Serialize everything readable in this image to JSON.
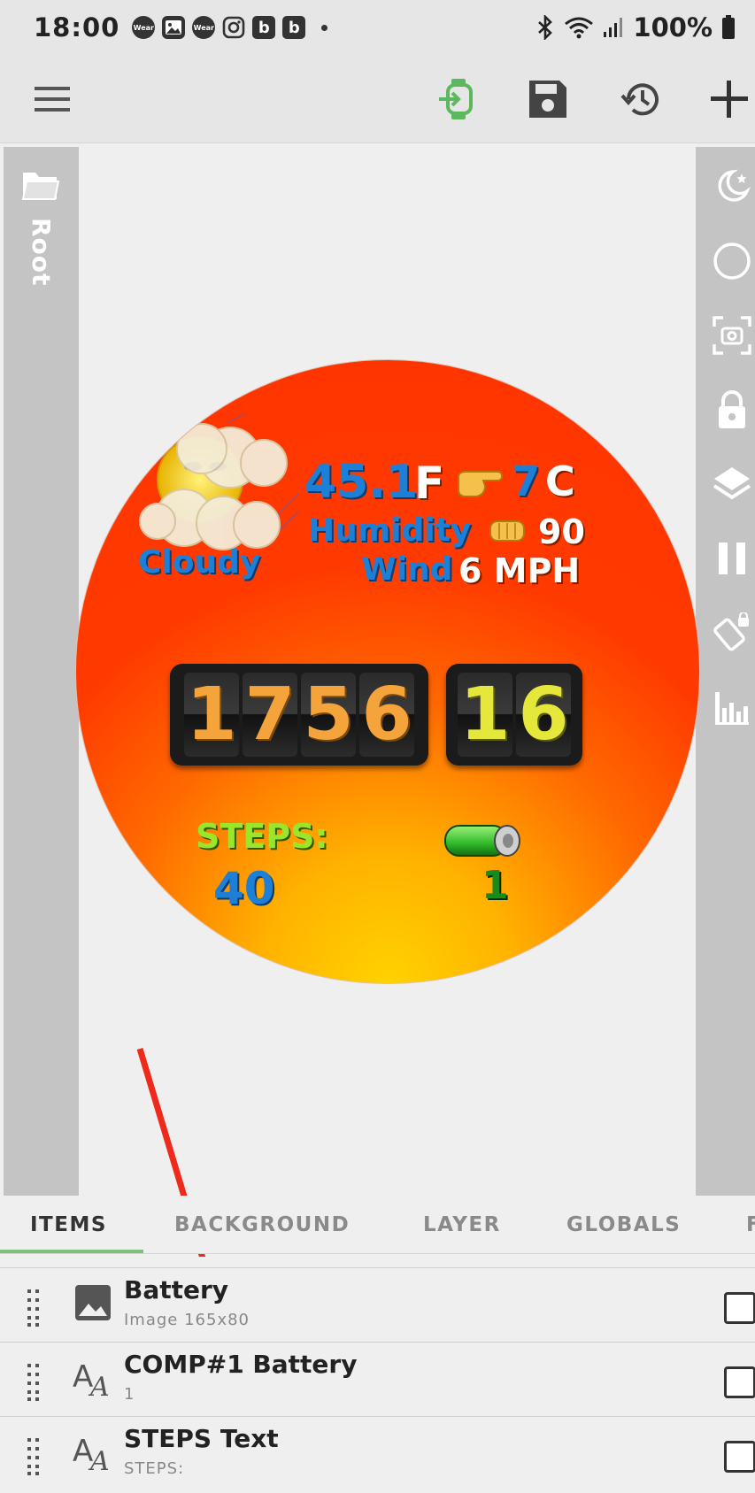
{
  "status_bar": {
    "time": "18:00",
    "notification_icons": [
      "Wear",
      "image-icon",
      "Wear",
      "instagram-icon",
      "b",
      "b"
    ],
    "battery_percent": "100%"
  },
  "toolbar": {
    "menu_icon": "hamburger-menu-icon",
    "watch_sync_icon": "watch-sync-icon",
    "save_icon": "save-icon",
    "history_icon": "history-icon",
    "add_icon": "plus-icon",
    "accent_color": "#5cb85c"
  },
  "left_panel": {
    "label": "Root"
  },
  "watch_face": {
    "condition": "Cloudy",
    "temp_f": "45.1",
    "unit_f": "F",
    "temp_c": "7",
    "unit_c": "C",
    "humidity_label": "Humidity",
    "humidity_value": "90",
    "wind_label": "Wind",
    "wind_value": "6 MPH",
    "time_digits": [
      "1",
      "7",
      "5",
      "6"
    ],
    "seconds_digits": [
      "1",
      "6"
    ],
    "steps_label": "STEPS:",
    "steps_value": "40",
    "battery_value": "1",
    "colors": {
      "face": "#ff3300",
      "blue_text": "#1e7fd6",
      "steps_green": "#9be52a",
      "digit_orange": "#f4a43a",
      "digit_yellow": "#e5e83a"
    }
  },
  "tabs": [
    {
      "label": "ITEMS",
      "active": true
    },
    {
      "label": "BACKGROUND",
      "active": false
    },
    {
      "label": "LAYER",
      "active": false
    },
    {
      "label": "GLOBALS",
      "active": false
    },
    {
      "label": "F",
      "active": false
    }
  ],
  "items": [
    {
      "title": "Battery",
      "subtitle": "Image 165x80",
      "icon": "image-icon"
    },
    {
      "title": "COMP#1 Battery",
      "subtitle": "1",
      "icon": "text-icon"
    },
    {
      "title": "STEPS Text",
      "subtitle": "STEPS:",
      "icon": "text-icon"
    }
  ]
}
